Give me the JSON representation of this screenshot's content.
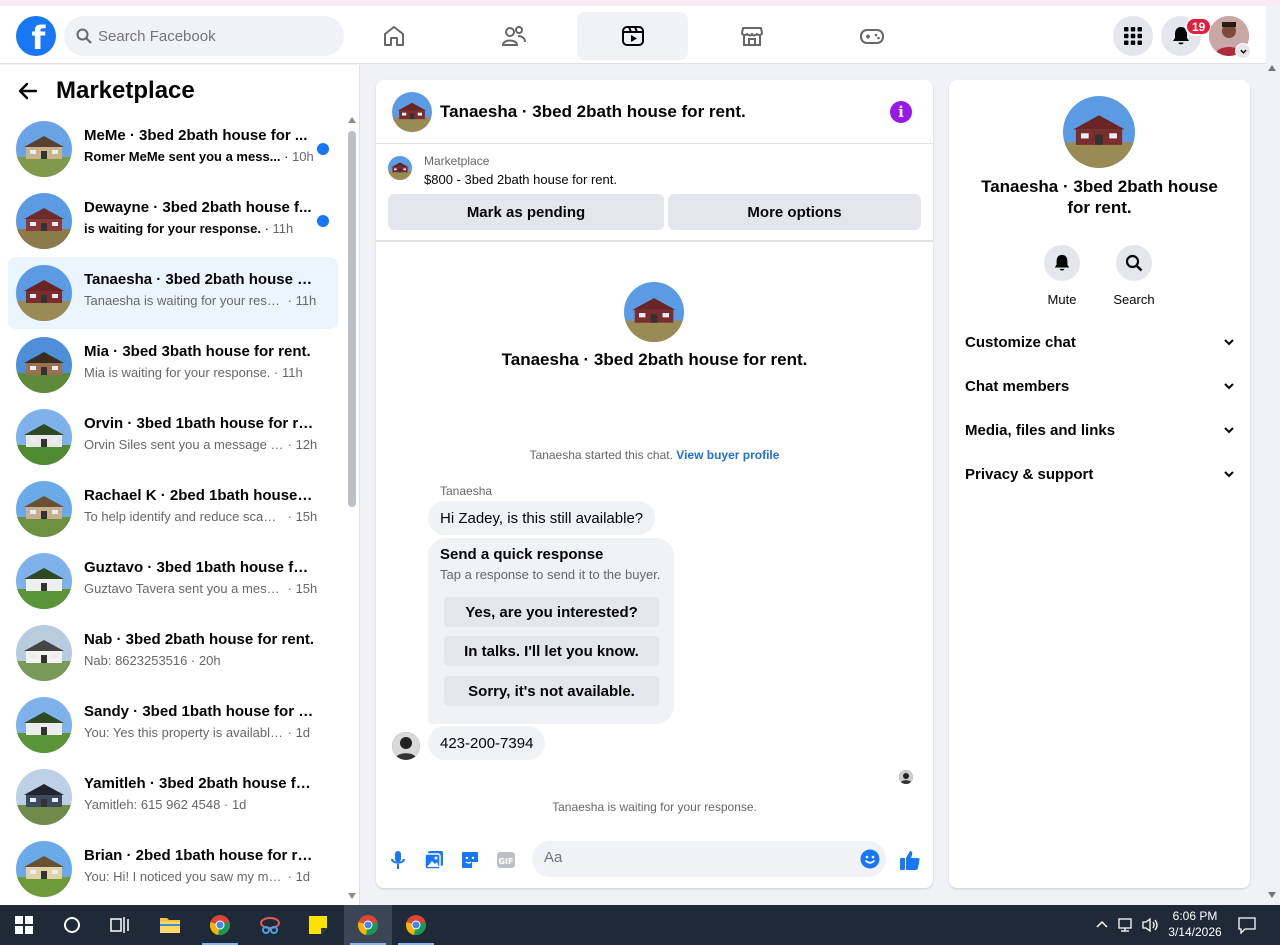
{
  "topbar": {
    "logo_letter": "f",
    "search_placeholder": "Search Facebook",
    "nav": [
      "home-icon",
      "friends-icon",
      "video-icon",
      "marketplace-icon",
      "gaming-icon"
    ],
    "notification_count": "19"
  },
  "sidebar": {
    "title": "Marketplace",
    "conversations": [
      {
        "title": "MeMe · 3bed 2bath house for ...",
        "subtitle": "Romer MeMe sent you a mess...",
        "time": "10h",
        "unread": true,
        "selected": false
      },
      {
        "title": "Dewayne · 3bed 2bath house f...",
        "subtitle": "is waiting for your response.",
        "time": "11h",
        "unread": true,
        "selected": false
      },
      {
        "title": "Tanaesha · 3bed 2bath house for...",
        "subtitle": "Tanaesha is waiting for your respo...",
        "time": "11h",
        "unread": false,
        "selected": true
      },
      {
        "title": "Mia · 3bed 3bath house for rent.",
        "subtitle": "Mia is waiting for your response.",
        "time": "11h",
        "unread": false,
        "selected": false
      },
      {
        "title": "Orvin · 3bed 1bath house for rent.",
        "subtitle": "Orvin Siles sent you a message ab...",
        "time": "12h",
        "unread": false,
        "selected": false
      },
      {
        "title": "Rachael K · 2bed 1bath house fo...",
        "subtitle": "To help identify and reduce scams...",
        "time": "15h",
        "unread": false,
        "selected": false
      },
      {
        "title": "Guztavo · 3bed 1bath house for ...",
        "subtitle": "Guztavo Tavera sent you a messag...",
        "time": "15h",
        "unread": false,
        "selected": false
      },
      {
        "title": "Nab · 3bed 2bath house for rent.",
        "subtitle": "Nab: 8623253516",
        "time": "20h",
        "unread": false,
        "selected": false
      },
      {
        "title": "Sandy · 3bed 1bath house for rent.",
        "subtitle": "You: Yes this property is available. F...",
        "time": "1d",
        "unread": false,
        "selected": false
      },
      {
        "title": "Yamitleh · 3bed 2bath house for ...",
        "subtitle": "Yamitleh: 615 962 4548",
        "time": "1d",
        "unread": false,
        "selected": false
      },
      {
        "title": "Brian · 2bed 1bath house for rent.",
        "subtitle": "You: Hi! I noticed you saw my mess...",
        "time": "1d",
        "unread": false,
        "selected": false
      }
    ]
  },
  "chat": {
    "title": "Tanaesha · 3bed 2bath house for rent.",
    "marketplace_label": "Marketplace",
    "listing": "$800 - 3bed 2bath house for rent.",
    "mark_pending": "Mark as pending",
    "more_options": "More options",
    "intro_title": "Tanaesha · 3bed 2bath house for rent.",
    "started_text": "Tanaesha started this chat.",
    "view_profile": "View buyer profile",
    "sender_name": "Tanaesha",
    "message1": "Hi Zadey, is this still available?",
    "quick_heading": "Send a quick response",
    "quick_sub": "Tap a response to send it to the buyer.",
    "quick_options": [
      "Yes, are you interested?",
      "In talks. I'll let you know.",
      "Sorry, it's not available."
    ],
    "message2": "423-200-7394",
    "waiting": "Tanaesha is waiting for your response.",
    "composer_placeholder": "Aa"
  },
  "details": {
    "title": "Tanaesha · 3bed 2bath house for rent.",
    "mute": "Mute",
    "search": "Search",
    "sections": [
      "Customize chat",
      "Chat members",
      "Media, files and links",
      "Privacy & support"
    ]
  },
  "taskbar": {
    "time": "6:06 PM",
    "date": "3/14/2026"
  },
  "colors": {
    "brand": "#1877f2",
    "selected_bg": "#ebf5ff",
    "info_purple": "#9818e6",
    "badge_red": "#e41e3f"
  }
}
